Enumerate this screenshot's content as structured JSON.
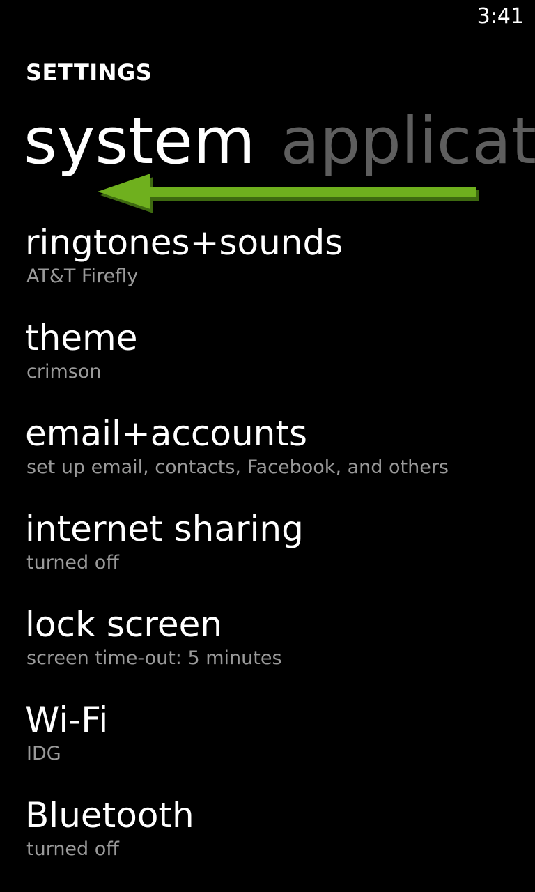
{
  "status_bar": {
    "time": "3:41"
  },
  "app": {
    "title": "SETTINGS"
  },
  "pivot": {
    "tabs": [
      {
        "label": "system",
        "active": true
      },
      {
        "label": "applicat",
        "active": false
      }
    ]
  },
  "colors": {
    "background": "#000000",
    "text_primary": "#ffffff",
    "text_secondary": "#9a9a9a",
    "inactive_tab": "#5e5e5e",
    "swipe_arrow": "#6fb01e"
  },
  "annotation": {
    "icon": "swipe-left-arrow-icon"
  },
  "settings": {
    "items": [
      {
        "title": "ringtones+sounds",
        "subtitle": "AT&T Firefly"
      },
      {
        "title": "theme",
        "subtitle": "crimson"
      },
      {
        "title": "email+accounts",
        "subtitle": "set up email, contacts, Facebook, and others"
      },
      {
        "title": "internet sharing",
        "subtitle": "turned off"
      },
      {
        "title": "lock screen",
        "subtitle": "screen time-out: 5 minutes"
      },
      {
        "title": "Wi-Fi",
        "subtitle": "IDG"
      },
      {
        "title": "Bluetooth",
        "subtitle": "turned off"
      }
    ]
  }
}
